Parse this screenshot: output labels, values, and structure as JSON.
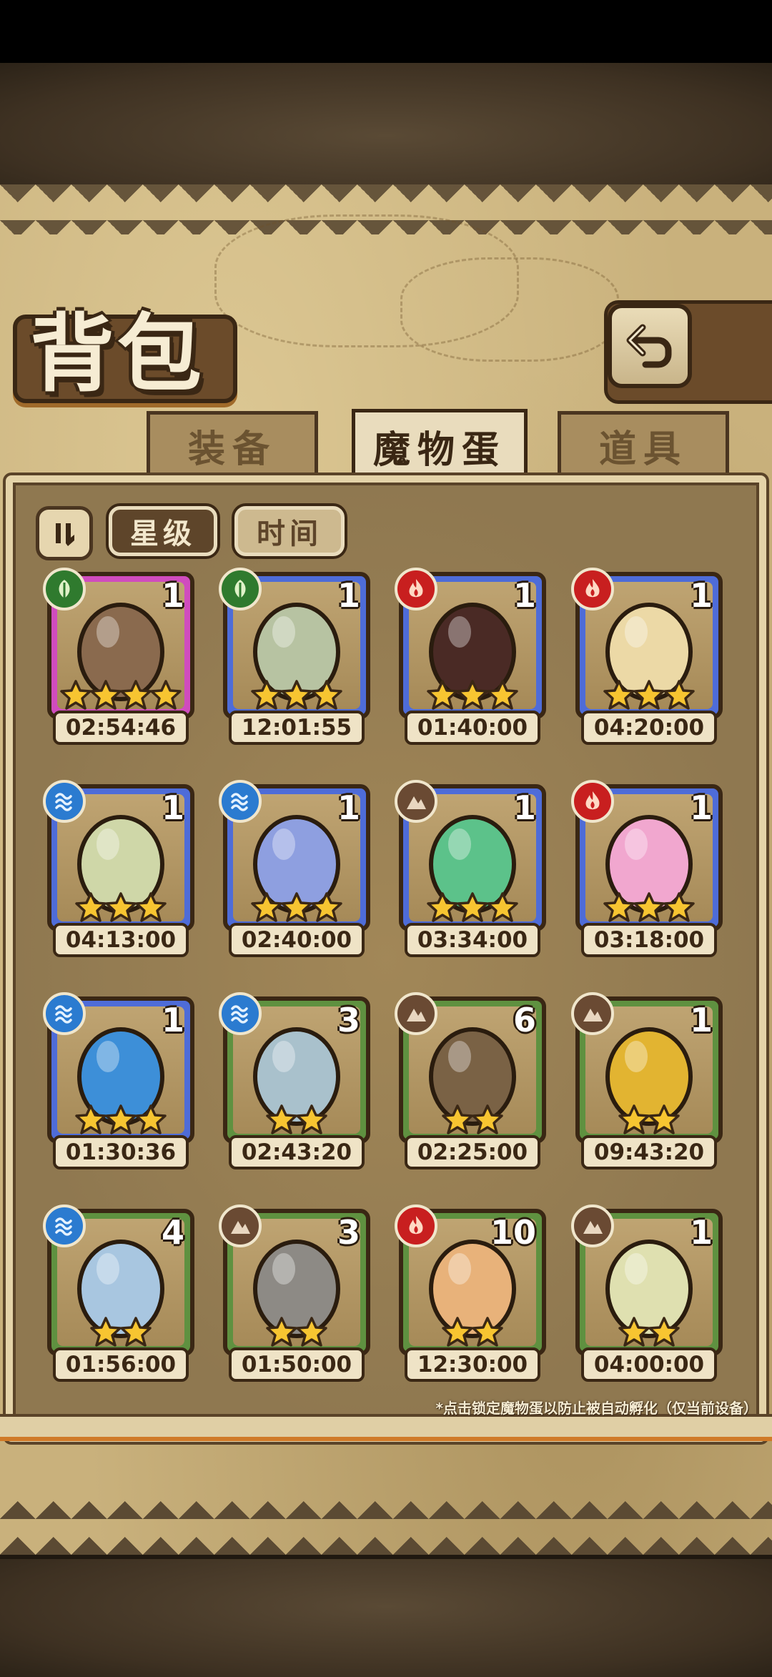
{
  "title": "背包",
  "tabs": [
    {
      "label": "装备",
      "active": false
    },
    {
      "label": "魔物蛋",
      "active": true
    },
    {
      "label": "道具",
      "active": false
    }
  ],
  "sort": {
    "toggle_icon": "sort-toggle-icon",
    "options": [
      {
        "label": "星级",
        "selected": true
      },
      {
        "label": "时间",
        "selected": false
      }
    ]
  },
  "eggs": [
    {
      "element": "leaf",
      "rarity": "pink",
      "qty": "1",
      "stars": 4,
      "timer": "02:54:46",
      "egg_color": "#8a6a4e"
    },
    {
      "element": "leaf",
      "rarity": "blue",
      "qty": "1",
      "stars": 3,
      "timer": "12:01:55",
      "egg_color": "#b7c3a2"
    },
    {
      "element": "fire",
      "rarity": "blue",
      "qty": "1",
      "stars": 3,
      "timer": "01:40:00",
      "egg_color": "#4a2a25"
    },
    {
      "element": "fire",
      "rarity": "blue",
      "qty": "1",
      "stars": 3,
      "timer": "04:20:00",
      "egg_color": "#ecd9a6"
    },
    {
      "element": "water",
      "rarity": "blue",
      "qty": "1",
      "stars": 3,
      "timer": "04:13:00",
      "egg_color": "#cfd7a8"
    },
    {
      "element": "water",
      "rarity": "blue",
      "qty": "1",
      "stars": 3,
      "timer": "02:40:00",
      "egg_color": "#8e9fe0"
    },
    {
      "element": "earth",
      "rarity": "blue",
      "qty": "1",
      "stars": 3,
      "timer": "03:34:00",
      "egg_color": "#5cc28a"
    },
    {
      "element": "fire",
      "rarity": "blue",
      "qty": "1",
      "stars": 3,
      "timer": "03:18:00",
      "egg_color": "#f1a7cf"
    },
    {
      "element": "water",
      "rarity": "blue",
      "qty": "1",
      "stars": 3,
      "timer": "01:30:36",
      "egg_color": "#3d8fd8"
    },
    {
      "element": "water",
      "rarity": "green",
      "qty": "3",
      "stars": 2,
      "timer": "02:43:20",
      "egg_color": "#a9c1cc"
    },
    {
      "element": "earth",
      "rarity": "green",
      "qty": "6",
      "stars": 2,
      "timer": "02:25:00",
      "egg_color": "#7a6245"
    },
    {
      "element": "earth",
      "rarity": "green",
      "qty": "1",
      "stars": 2,
      "timer": "09:43:20",
      "egg_color": "#e2b431"
    },
    {
      "element": "water",
      "rarity": "green",
      "qty": "4",
      "stars": 2,
      "timer": "01:56:00",
      "egg_color": "#a8c6e0"
    },
    {
      "element": "earth",
      "rarity": "green",
      "qty": "3",
      "stars": 2,
      "timer": "01:50:00",
      "egg_color": "#8d8a85"
    },
    {
      "element": "fire",
      "rarity": "green",
      "qty": "10",
      "stars": 2,
      "timer": "12:30:00",
      "egg_color": "#e8b27a"
    },
    {
      "element": "earth",
      "rarity": "green",
      "qty": "1",
      "stars": 2,
      "timer": "04:00:00",
      "egg_color": "#dfe0b0"
    }
  ],
  "footnote": "*点击锁定魔物蛋以防止被自动孵化（仅当前设备）",
  "colors": {
    "rarity_pink": "#d04cbe",
    "rarity_blue": "#4e6cd8",
    "rarity_green": "#5f9140",
    "star": "#f7c531"
  }
}
